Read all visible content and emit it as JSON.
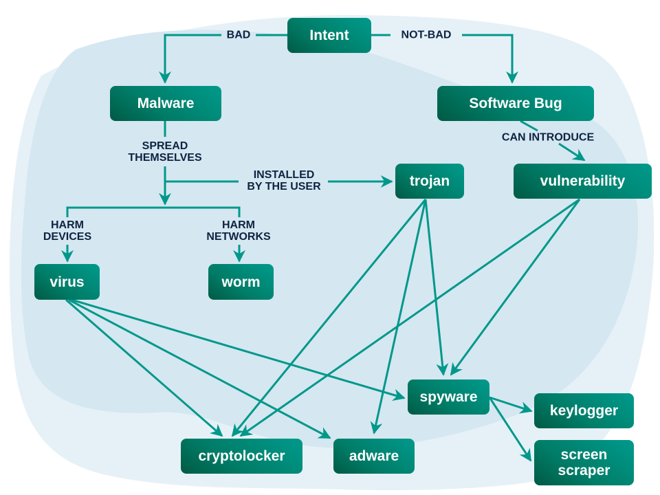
{
  "colors": {
    "node_dark": "#005a44",
    "node_light": "#009a8c",
    "edge": "#00988a",
    "label_text": "#0d2340",
    "blob_outer": "#e6f1f7",
    "blob_inner": "#d5e7f1"
  },
  "nodes": {
    "intent": "Intent",
    "malware": "Malware",
    "software_bug": "Software Bug",
    "trojan": "trojan",
    "vulnerability": "vulnerability",
    "virus": "virus",
    "worm": "worm",
    "spyware": "spyware",
    "keylogger": "keylogger",
    "screen_scraper": [
      "screen",
      "scraper"
    ],
    "cryptolocker": "cryptolocker",
    "adware": "adware"
  },
  "edge_labels": {
    "bad": "BAD",
    "not_bad": "NOT-BAD",
    "spread_themselves": [
      "SPREAD",
      "THEMSELVES"
    ],
    "installed_by_user": [
      "INSTALLED",
      "BY THE USER"
    ],
    "can_introduce": "CAN INTRODUCE",
    "harm_devices": [
      "HARM",
      "DEVICES"
    ],
    "harm_networks": [
      "HARM",
      "NETWORKS"
    ]
  },
  "edges": [
    {
      "from": "intent",
      "to": "malware",
      "label": "BAD"
    },
    {
      "from": "intent",
      "to": "software_bug",
      "label": "NOT-BAD"
    },
    {
      "from": "malware",
      "to": "virus",
      "label": "SPREAD THEMSELVES / HARM DEVICES"
    },
    {
      "from": "malware",
      "to": "worm",
      "label": "SPREAD THEMSELVES / HARM NETWORKS"
    },
    {
      "from": "malware",
      "to": "trojan",
      "label": "INSTALLED BY THE USER"
    },
    {
      "from": "software_bug",
      "to": "vulnerability",
      "label": "CAN INTRODUCE"
    },
    {
      "from": "trojan",
      "to": "cryptolocker"
    },
    {
      "from": "trojan",
      "to": "adware"
    },
    {
      "from": "trojan",
      "to": "spyware"
    },
    {
      "from": "vulnerability",
      "to": "cryptolocker"
    },
    {
      "from": "vulnerability",
      "to": "spyware"
    },
    {
      "from": "virus",
      "to": "cryptolocker"
    },
    {
      "from": "virus",
      "to": "adware"
    },
    {
      "from": "virus",
      "to": "spyware"
    },
    {
      "from": "spyware",
      "to": "keylogger"
    },
    {
      "from": "spyware",
      "to": "screen_scraper"
    }
  ]
}
